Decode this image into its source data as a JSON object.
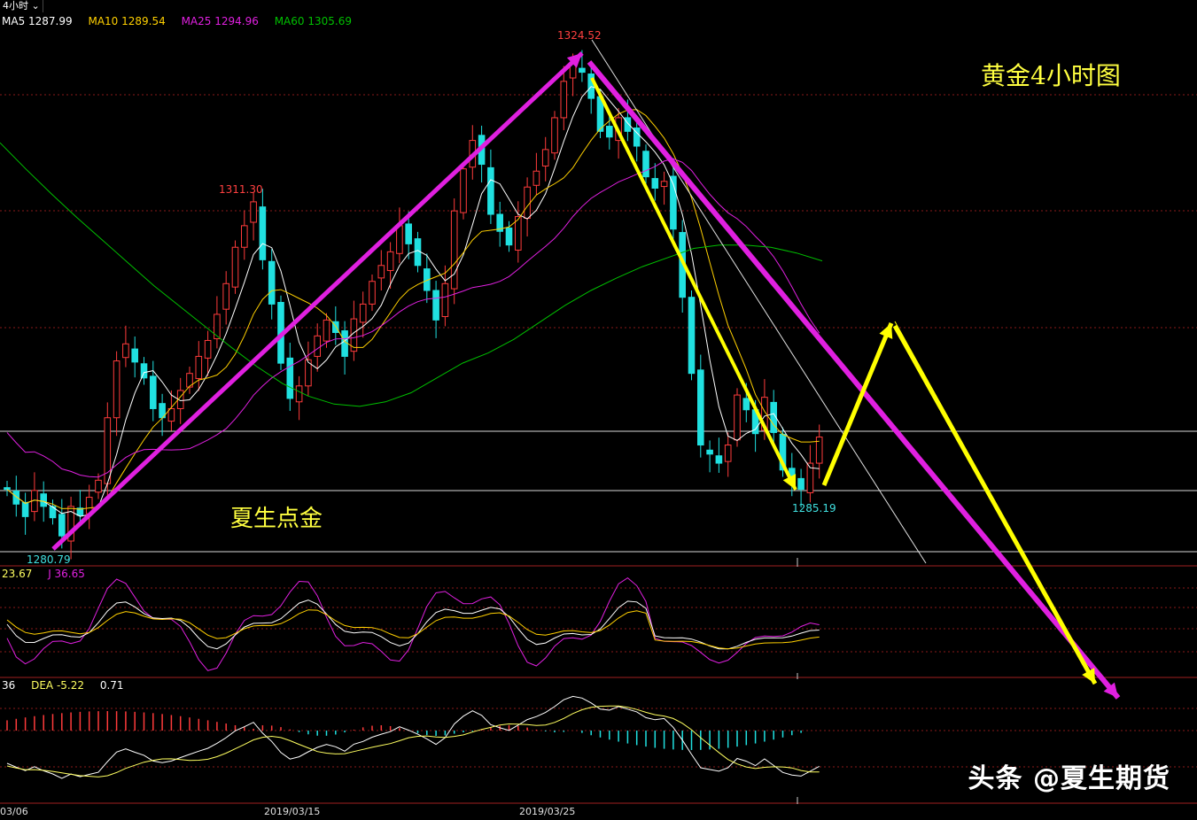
{
  "header": {
    "period_label": "4小时",
    "period_icon": "chevron-down-icon"
  },
  "ma_legend": [
    {
      "label": "MA5 1287.99",
      "color": "#ffffff"
    },
    {
      "label": "MA10 1289.54",
      "color": "#ffd000"
    },
    {
      "label": "MA25 1294.96",
      "color": "#e020e0"
    },
    {
      "label": "MA60 1305.69",
      "color": "#00c000"
    }
  ],
  "kdj_legend": [
    {
      "label": "23.67",
      "color": "#ffff60"
    },
    {
      "label": "J 36.65",
      "color": "#e020e0"
    }
  ],
  "macd_legend": [
    {
      "label": "36",
      "color": "#ffffff"
    },
    {
      "label": "DEA -5.22",
      "color": "#ffff60"
    },
    {
      "label": "0.71",
      "color": "#ffffff"
    }
  ],
  "annotations": {
    "chart_title": "黄金4小时图",
    "author_label": "夏生点金",
    "watermark": "头条 @夏生期货"
  },
  "colors": {
    "up": "#ff3b3b",
    "down": "#20e0e0",
    "ma5": "#ffffff",
    "ma10": "#ffd000",
    "ma25": "#e020e0",
    "ma60": "#00c000",
    "trend_magenta": "#e020e0",
    "trend_yellow": "#ffff00",
    "grid": "#8a1a1a"
  },
  "chart_data": {
    "type": "line",
    "symbol": "黄金",
    "timeframe": "4小时",
    "x_dates": [
      "03/06",
      "2019/03/15",
      "2019/03/25"
    ],
    "price_labels": {
      "high": "1324.52",
      "swing_high": "1311.30",
      "low": "1280.79",
      "recent_low": "1285.19"
    },
    "ylim": [
      1279,
      1327
    ],
    "grid": true,
    "close_path": [
      1285.5,
      1284.2,
      1283.1,
      1285.4,
      1284.0,
      1283.0,
      1281.4,
      1284.0,
      1283.2,
      1284.8,
      1286.3,
      1291.8,
      1296.8,
      1298.3,
      1296.7,
      1295.3,
      1292.6,
      1291.8,
      1292.6,
      1294.2,
      1295.7,
      1297.2,
      1298.6,
      1300.9,
      1303.6,
      1306.8,
      1308.7,
      1310.8,
      1305.7,
      1301.8,
      1296.6,
      1293.5,
      1294.6,
      1296.9,
      1299.0,
      1300.4,
      1299.3,
      1297.2,
      1300.5,
      1301.8,
      1303.8,
      1305.2,
      1306.4,
      1308.7,
      1307.1,
      1305.2,
      1303.0,
      1300.4,
      1303.6,
      1310.0,
      1313.7,
      1316.2,
      1314.1,
      1309.7,
      1308.2,
      1307.0,
      1309.5,
      1312.1,
      1313.5,
      1315.4,
      1318.2,
      1321.4,
      1323.0,
      1322.2,
      1319.9,
      1317.0,
      1316.5,
      1318.2,
      1317.0,
      1315.7,
      1313.0,
      1312.0,
      1312.6,
      1308.4,
      1302.4,
      1295.7,
      1289.4,
      1288.6,
      1287.8,
      1289.4,
      1293.8,
      1292.5,
      1290.4,
      1293.6,
      1290.5,
      1287.2,
      1286.0,
      1285.5,
      1287.8,
      1290.1
    ],
    "ma60_path": [
      1316.0,
      1313.7,
      1311.5,
      1309.4,
      1307.4,
      1305.4,
      1303.4,
      1301.6,
      1299.8,
      1298.0,
      1296.3,
      1294.8,
      1293.7,
      1293.0,
      1292.8,
      1293.2,
      1294.0,
      1295.3,
      1296.6,
      1297.5,
      1298.7,
      1300.2,
      1301.7,
      1303.0,
      1304.1,
      1305.1,
      1305.9,
      1306.7,
      1307.0,
      1307.0,
      1306.8,
      1306.3,
      1305.6
    ],
    "macd_histogram_sign": "positive early, negative mid, near zero at end",
    "forecast": "retest near 1300 then decline below 1285",
    "series": [
      {
        "name": "MA5",
        "value": 1287.99
      },
      {
        "name": "MA10",
        "value": 1289.54
      },
      {
        "name": "MA25",
        "value": 1294.96
      },
      {
        "name": "MA60",
        "value": 1305.69
      }
    ]
  }
}
